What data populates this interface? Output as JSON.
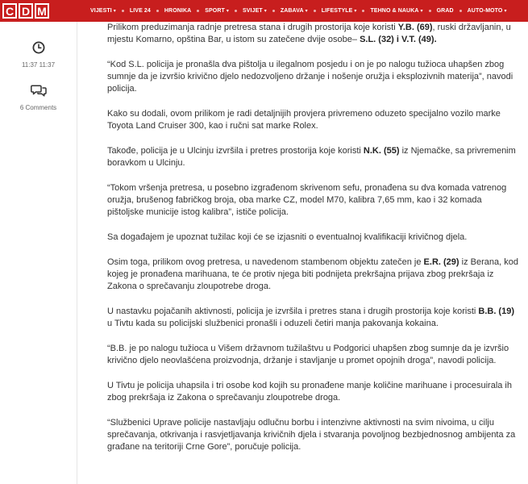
{
  "brand": {
    "letters": [
      "C",
      "D",
      "M"
    ],
    "color": "#c81e1e"
  },
  "nav": {
    "items": [
      {
        "label": "VIJESTI",
        "has_dropdown": true
      },
      {
        "label": "LIVE 24",
        "has_dropdown": false
      },
      {
        "label": "HRONIKA",
        "has_dropdown": false
      },
      {
        "label": "SPORT",
        "has_dropdown": true
      },
      {
        "label": "SVIJET",
        "has_dropdown": true
      },
      {
        "label": "ZABAVA",
        "has_dropdown": true
      },
      {
        "label": "LIFESTYLE",
        "has_dropdown": true
      },
      {
        "label": "TEHNO & NAUKA",
        "has_dropdown": true
      },
      {
        "label": "GRAD",
        "has_dropdown": false
      },
      {
        "label": "AUTO-MOTO",
        "has_dropdown": true
      }
    ],
    "caret": "▾"
  },
  "meta": {
    "time": "11:37 11:37",
    "time_icon": "clock-icon",
    "comments": "6 Comments",
    "comments_icon": "comments-icon"
  },
  "article": {
    "paragraphs": [
      [
        {
          "t": "Prilikom preduzimanja radnje pretresa stana i drugih prostorija koje koristi "
        },
        {
          "t": "Y.B. (69)",
          "b": true
        },
        {
          "t": ", ruski državljanin, u mjestu Komarno, opština Bar, u istom su zatečene dvije osobe– "
        },
        {
          "t": "S.L. (32) i V.T. (49).",
          "b": true
        }
      ],
      [
        {
          "t": "“Kod S.L. policija je pronašla dva pištolja u ilegalnom posjedu i on je po nalogu tužioca uhapšen zbog sumnje da je izvršio krivično djelo nedozvoljeno držanje i nošenje oružja i eksplozivnih materija”, navodi policija."
        }
      ],
      [
        {
          "t": "Kako su dodali, ovom prilikom je radi detaljnijih provjera privremeno oduzeto specijalno vozilo marke Toyota Land Cruiser 300, kao i ručni sat marke Rolex."
        }
      ],
      [
        {
          "t": "Takođe, policija je u Ulcinju izvršila i pretres prostorija koje koristi "
        },
        {
          "t": "N.K. (55)",
          "b": true
        },
        {
          "t": " iz Njemačke, sa privremenim boravkom u Ulcinju."
        }
      ],
      [
        {
          "t": "“Tokom vršenja pretresa, u posebno izgrađenom skrivenom sefu, pronađena su dva komada vatrenog oružja, brušenog fabričkog broja, oba marke CZ, model M70, kalibra 7,65 mm, kao i 32 komada pištoljske municije istog kalibra”, ističe policija."
        }
      ],
      [
        {
          "t": "Sa događajem je upoznat tužilac koji će se izjasniti o eventualnoj kvalifikaciji krivičnog djela."
        }
      ],
      [
        {
          "t": "Osim toga, prilikom ovog pretresa, u navedenom stambenom objektu zatečen je "
        },
        {
          "t": "E.R. (29)",
          "b": true
        },
        {
          "t": " iz Berana, kod kojeg je pronađena marihuana, te će protiv njega biti podnijeta prekršajna prijava zbog prekršaja iz Zakona o sprečavanju zloupotrebe droga."
        }
      ],
      [
        {
          "t": "U nastavku pojačanih aktivnosti, policija je izvršila i pretres stana i drugih prostorija koje koristi "
        },
        {
          "t": "B.B. (19)",
          "b": true
        },
        {
          "t": " u Tivtu kada su policijski službenici pronašli i oduzeli četiri manja pakovanja kokaina."
        }
      ],
      [
        {
          "t": "“B.B. je po nalogu tužioca u Višem državnom tužilaštvu u Podgorici uhapšen zbog sumnje da je izvršio krivično djelo neovlašćena proizvodnja, držanje i stavljanje u promet opojnih droga”, navodi policija."
        }
      ],
      [
        {
          "t": "U Tivtu je policija uhapsila i tri osobe kod kojih su pronađene manje količine marihuane i procesuirala ih zbog prekršaja iz Zakona o sprečavanju zloupotrebe droga."
        }
      ],
      [
        {
          "t": "“Službenici Uprave policije nastavljaju odlučnu borbu i intenzivne aktivnosti na svim nivoima, u cilju sprečavanja, otkrivanja i rasvjetljavanja krivičnih djela i stvaranja povoljnog bezbjednosnog ambijenta za građane na teritoriji Crne Gore”, poručuje policija."
        }
      ]
    ]
  }
}
